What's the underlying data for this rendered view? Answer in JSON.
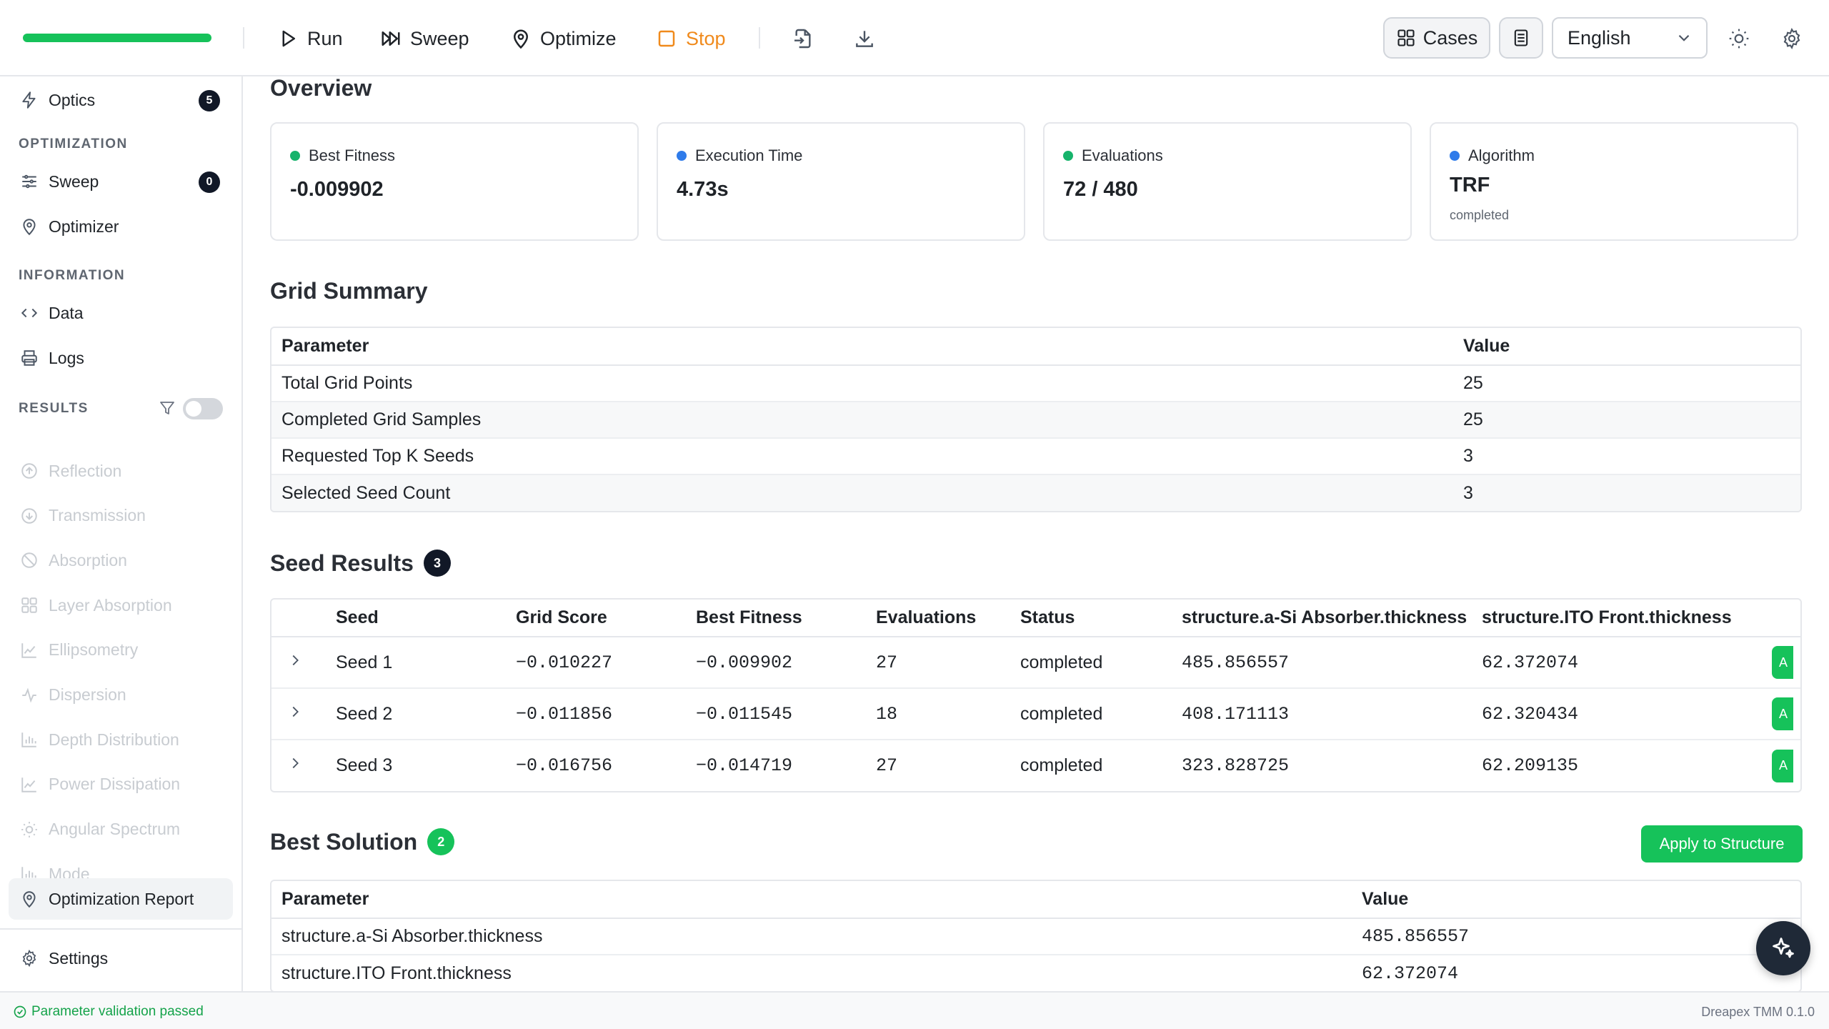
{
  "toolbar": {
    "run_label": "Run",
    "sweep_label": "Sweep",
    "optimize_label": "Optimize",
    "stop_label": "Stop",
    "cases_label": "Cases",
    "language": "English",
    "progress_fraction": 1.0,
    "progress_color": "#16c25a",
    "stop_color": "#f08a1c"
  },
  "sidebar": {
    "optics": {
      "label": "Optics",
      "badge": "5"
    },
    "optimization_header": "OPTIMIZATION",
    "sweep": {
      "label": "Sweep",
      "badge": "0"
    },
    "optimizer": {
      "label": "Optimizer"
    },
    "information_header": "INFORMATION",
    "data": {
      "label": "Data"
    },
    "logs": {
      "label": "Logs"
    },
    "results_header": "RESULTS",
    "results_filter_on": false,
    "results": [
      {
        "label": "Reflection",
        "icon": "arrow-up-circle-icon"
      },
      {
        "label": "Transmission",
        "icon": "arrow-down-circle-icon"
      },
      {
        "label": "Absorption",
        "icon": "ban-icon"
      },
      {
        "label": "Layer Absorption",
        "icon": "grid-icon"
      },
      {
        "label": "Ellipsometry",
        "icon": "line-chart-icon"
      },
      {
        "label": "Dispersion",
        "icon": "activity-icon"
      },
      {
        "label": "Depth Distribution",
        "icon": "bar-chart-icon"
      },
      {
        "label": "Power Dissipation",
        "icon": "line-chart-icon"
      },
      {
        "label": "Angular Spectrum",
        "icon": "sun-icon"
      },
      {
        "label": "Mode",
        "icon": "bar-chart-icon"
      }
    ],
    "optimization_report": {
      "label": "Optimization Report"
    },
    "settings": {
      "label": "Settings"
    }
  },
  "overview": {
    "title": "Overview",
    "cards": [
      {
        "label": "Best Fitness",
        "value": "-0.009902",
        "dot_color": "#16b36b"
      },
      {
        "label": "Execution Time",
        "value": "4.73s",
        "dot_color": "#2f7bea"
      },
      {
        "label": "Evaluations",
        "value": "72 / 480",
        "dot_color": "#16b36b"
      },
      {
        "label": "Algorithm",
        "value": "TRF",
        "sub": "completed",
        "dot_color": "#2f7bea"
      }
    ]
  },
  "grid_summary": {
    "title": "Grid Summary",
    "headers": [
      "Parameter",
      "Value"
    ],
    "rows": [
      [
        "Total Grid Points",
        "25"
      ],
      [
        "Completed Grid Samples",
        "25"
      ],
      [
        "Requested Top K Seeds",
        "3"
      ],
      [
        "Selected Seed Count",
        "3"
      ]
    ]
  },
  "seed_results": {
    "title": "Seed Results",
    "count": "3",
    "headers": [
      "Seed",
      "Grid Score",
      "Best Fitness",
      "Evaluations",
      "Status",
      "structure.a-Si Absorber.thickness",
      "structure.ITO Front.thickness"
    ],
    "apply_label": "A",
    "rows": [
      [
        "Seed 1",
        "−0.010227",
        "−0.009902",
        "27",
        "completed",
        "485.856557",
        "62.372074"
      ],
      [
        "Seed 2",
        "−0.011856",
        "−0.011545",
        "18",
        "completed",
        "408.171113",
        "62.320434"
      ],
      [
        "Seed 3",
        "−0.016756",
        "−0.014719",
        "27",
        "completed",
        "323.828725",
        "62.209135"
      ]
    ]
  },
  "best_solution": {
    "title": "Best Solution",
    "count": "2",
    "apply_label": "Apply to Structure",
    "headers": [
      "Parameter",
      "Value"
    ],
    "rows": [
      [
        "structure.a-Si Absorber.thickness",
        "485.856557"
      ],
      [
        "structure.ITO Front.thickness",
        "62.372074"
      ]
    ]
  },
  "status": {
    "message": "Parameter validation passed",
    "version": "Dreapex TMM 0.1.0"
  }
}
